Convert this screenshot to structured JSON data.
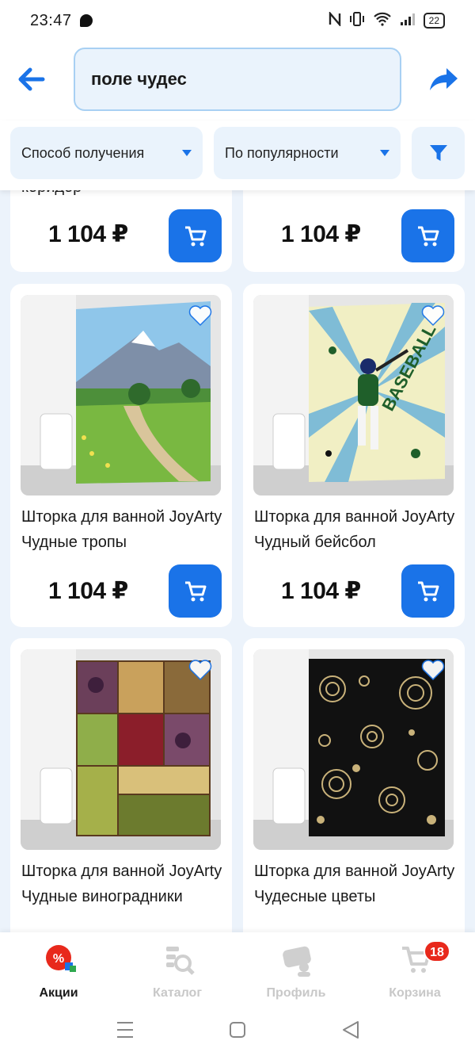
{
  "status_bar": {
    "time": "23:47",
    "battery": "22"
  },
  "search": {
    "query": "поле чудес"
  },
  "filters": {
    "delivery": "Способ получения",
    "sort": "По популярности"
  },
  "products": [
    {
      "title": "коридор",
      "price": "1 104 ₽"
    },
    {
      "title": "",
      "price": "1 104 ₽"
    },
    {
      "title": "Шторка для ванной JoyArty Чудные тропы",
      "price": "1 104 ₽"
    },
    {
      "title": "Шторка для ванной JoyArty Чудный бейсбол",
      "price": "1 104 ₽"
    },
    {
      "title": "Шторка для ванной JoyArty Чудные виноградники",
      "price": ""
    },
    {
      "title": "Шторка для ванной JoyArty Чудесные цветы",
      "price": ""
    }
  ],
  "image_text": {
    "baseball": "BASEBALL"
  },
  "bottom_nav": [
    {
      "label": "Акции",
      "icon": "promo-icon",
      "active": true
    },
    {
      "label": "Каталог",
      "icon": "catalog-icon",
      "active": false
    },
    {
      "label": "Профиль",
      "icon": "profile-icon",
      "active": false
    },
    {
      "label": "Корзина",
      "icon": "cart-icon",
      "active": false,
      "badge": "18"
    }
  ],
  "colors": {
    "accent": "#1a73e8",
    "badge": "#e8291c",
    "background": "#ecf3fb"
  }
}
